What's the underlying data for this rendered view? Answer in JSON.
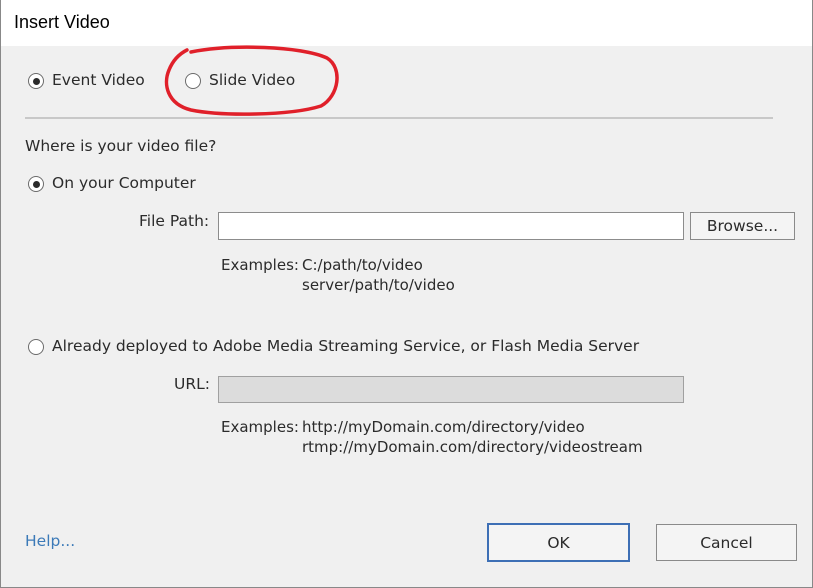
{
  "window": {
    "title": "Insert Video"
  },
  "video_type": {
    "event_label": "Event Video",
    "event_selected": true,
    "slide_label": "Slide Video",
    "slide_selected": false
  },
  "source": {
    "question": "Where is your video file?",
    "computer": {
      "label": "On your Computer",
      "selected": true,
      "file_path_label": "File Path:",
      "file_path_value": "",
      "browse_label": "Browse...",
      "examples_label": "Examples:",
      "example_1": "C:/path/to/video",
      "example_2": "server/path/to/video"
    },
    "deployed": {
      "label": "Already deployed to Adobe Media Streaming Service, or Flash Media Server",
      "selected": false,
      "url_label": "URL:",
      "url_value": "",
      "examples_label": "Examples:",
      "example_1": "http://myDomain.com/directory/video",
      "example_2": "rtmp://myDomain.com/directory/videostream"
    }
  },
  "footer": {
    "help_label": "Help...",
    "ok_label": "OK",
    "cancel_label": "Cancel"
  },
  "colors": {
    "annotation": "#e0202a",
    "link": "#3c7ab8",
    "default_button_border": "#3d6fb5"
  }
}
